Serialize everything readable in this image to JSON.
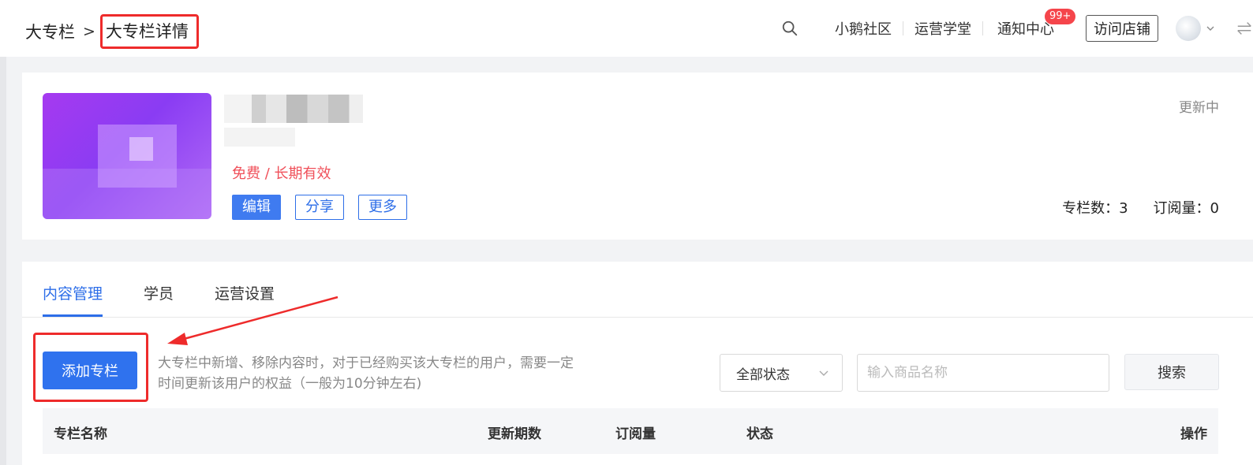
{
  "breadcrumb": {
    "root": "大专栏",
    "separator": ">",
    "current": "大专栏详情"
  },
  "nav": {
    "community": "小鹅社区",
    "academy": "运营学堂",
    "notice": "通知中心",
    "notice_badge": "99+",
    "visit_store": "访问店铺"
  },
  "product": {
    "price_validity": "免费 / 长期有效",
    "status": "更新中",
    "buttons": {
      "edit": "编辑",
      "share": "分享",
      "more": "更多"
    },
    "stats": {
      "columns": "专栏数：3",
      "subscribers": "订阅量：0"
    }
  },
  "tabs": [
    {
      "label": "内容管理",
      "active": true
    },
    {
      "label": "学员",
      "active": false
    },
    {
      "label": "运营设置",
      "active": false
    }
  ],
  "toolbar": {
    "add_label": "添加专栏",
    "hint": "大专栏中新增、移除内容时，对于已经购买该大专栏的用户，需要一定时间更新该用户的权益（一般为10分钟左右)",
    "status_filter": "全部状态",
    "search_placeholder": "输入商品名称",
    "search_label": "搜索"
  },
  "table": {
    "headers": [
      "专栏名称",
      "更新期数",
      "订阅量",
      "状态",
      "操作"
    ]
  },
  "colors": {
    "primary": "#2f72ee",
    "highlight": "#ee2b2b",
    "price": "#f0505a"
  }
}
